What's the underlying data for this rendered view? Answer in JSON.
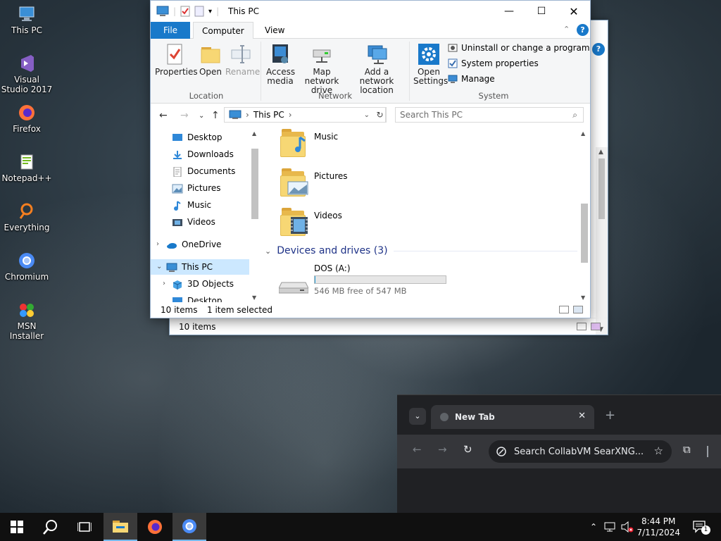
{
  "desktop": {
    "icons": [
      {
        "label": "This PC"
      },
      {
        "label": "Visual Studio 2017"
      },
      {
        "label": "Firefox"
      },
      {
        "label": "Notepad++"
      },
      {
        "label": "Everything"
      },
      {
        "label": "Chromium"
      },
      {
        "label": "MSN Installer"
      }
    ]
  },
  "back_window": {
    "status": "10 items"
  },
  "explorer": {
    "title": "This PC",
    "tabs": {
      "file": "File",
      "computer": "Computer",
      "view": "View"
    },
    "ribbon": {
      "location": {
        "label": "Location",
        "properties": "Properties",
        "open": "Open",
        "rename": "Rename"
      },
      "network": {
        "label": "Network",
        "access_media": "Access media",
        "map_drive": "Map network drive",
        "add_location": "Add a network location"
      },
      "system": {
        "label": "System",
        "open_settings": "Open Settings",
        "uninstall": "Uninstall or change a program",
        "system_properties": "System properties",
        "manage": "Manage"
      }
    },
    "address": {
      "path": "This PC"
    },
    "search": {
      "placeholder": "Search This PC"
    },
    "nav": {
      "desktop": "Desktop",
      "downloads": "Downloads",
      "documents": "Documents",
      "pictures": "Pictures",
      "music": "Music",
      "videos": "Videos",
      "onedrive": "OneDrive",
      "thispc": "This PC",
      "objects3d": "3D Objects",
      "desktop2": "Desktop"
    },
    "folders": {
      "music": "Music",
      "pictures": "Pictures",
      "videos": "Videos"
    },
    "devices": {
      "header": "Devices and drives (3)",
      "drive_name": "DOS (A:)",
      "drive_free": "546 MB free of 547 MB",
      "drive_used_fraction": 0.002
    },
    "status": {
      "items": "10 items",
      "selected": "1 item selected"
    }
  },
  "chromium": {
    "tab_title": "New Tab",
    "omnibox": "Search CollabVM SearXNG..."
  },
  "taskbar": {
    "time": "8:44 PM",
    "date": "7/11/2024",
    "notifications": "1"
  },
  "colors": {
    "accent": "#1979ca",
    "selection": "#cce8ff",
    "drive_bar": "#26a0da"
  }
}
